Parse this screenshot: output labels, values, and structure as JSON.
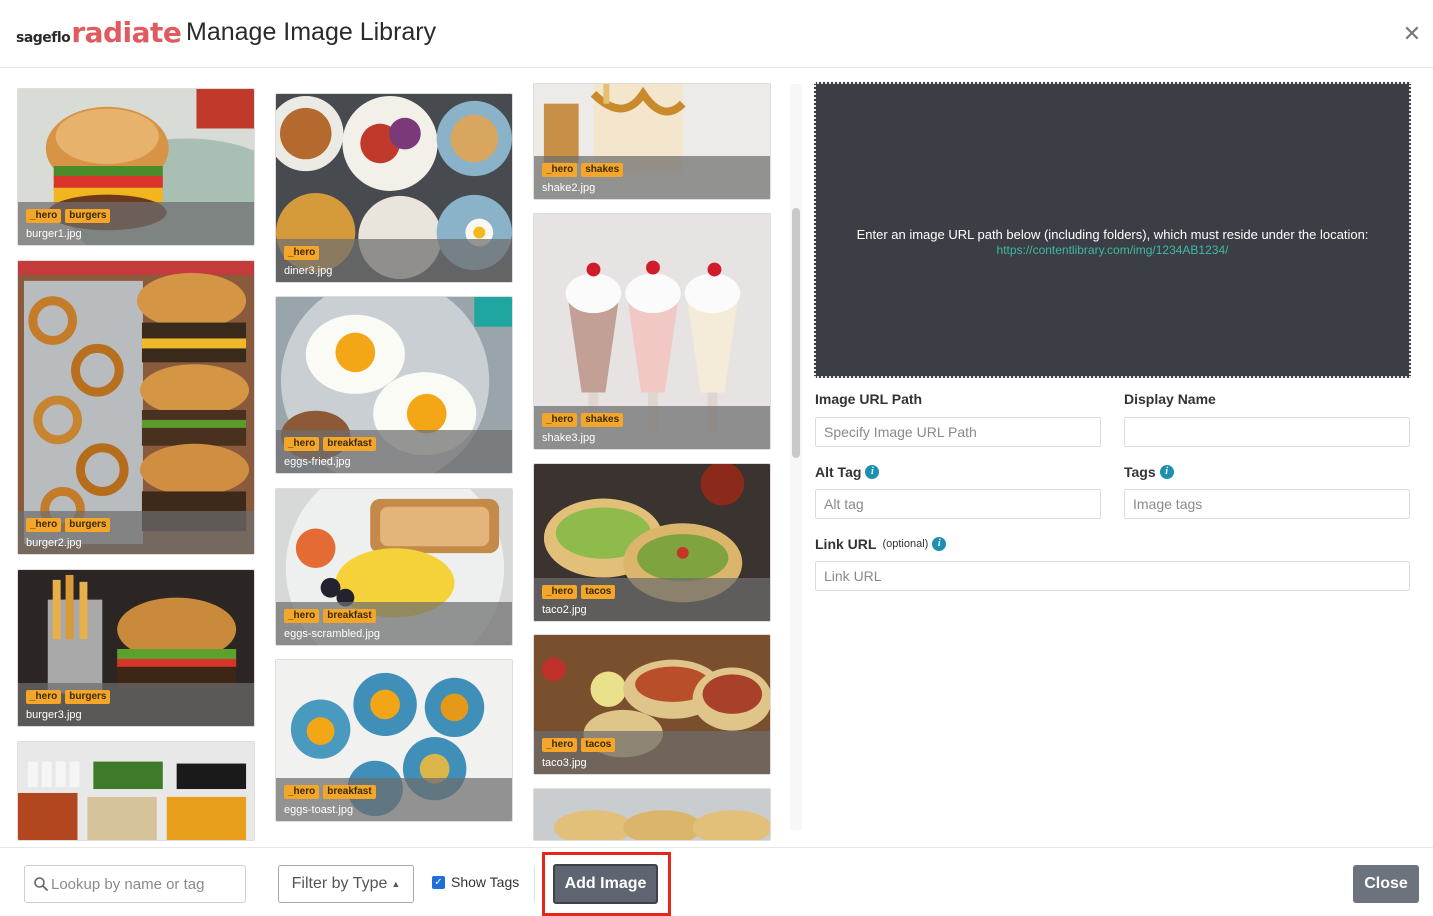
{
  "header": {
    "logo_small": "sageflo",
    "logo_big": "radiate",
    "title": "Manage Image Library"
  },
  "colors": {
    "brand": "#e05a5f",
    "tag": "#f3a62a",
    "link": "#3fb8a3",
    "info": "#1f8fb0",
    "highlight": "#e4261b"
  },
  "gallery": {
    "images": [
      {
        "file": "burger1.jpg",
        "tags": [
          "_hero",
          "burgers"
        ]
      },
      {
        "file": "burger2.jpg",
        "tags": [
          "_hero",
          "burgers"
        ]
      },
      {
        "file": "burger3.jpg",
        "tags": [
          "_hero",
          "burgers"
        ]
      },
      {
        "file": "",
        "tags": []
      },
      {
        "file": "diner3.jpg",
        "tags": [
          "_hero"
        ]
      },
      {
        "file": "eggs-fried.jpg",
        "tags": [
          "_hero",
          "breakfast"
        ]
      },
      {
        "file": "eggs-scrambled.jpg",
        "tags": [
          "_hero",
          "breakfast"
        ]
      },
      {
        "file": "eggs-toast.jpg",
        "tags": [
          "_hero",
          "breakfast"
        ]
      },
      {
        "file": "shake2.jpg",
        "tags": [
          "_hero",
          "shakes"
        ]
      },
      {
        "file": "shake3.jpg",
        "tags": [
          "_hero",
          "shakes"
        ]
      },
      {
        "file": "taco2.jpg",
        "tags": [
          "_hero",
          "tacos"
        ]
      },
      {
        "file": "taco3.jpg",
        "tags": [
          "_hero",
          "tacos"
        ]
      },
      {
        "file": "",
        "tags": []
      }
    ]
  },
  "panel": {
    "drop_text": "Enter an image URL path below (including folders), which must reside under the location:",
    "drop_url": "https://contentlibrary.com/img/1234AB1234/",
    "url_path_label": "Image URL Path",
    "url_path_placeholder": "Specify Image URL Path",
    "display_name_label": "Display Name",
    "display_name_value": "",
    "alt_tag_label": "Alt Tag",
    "alt_tag_placeholder": "Alt tag",
    "tags_label": "Tags",
    "tags_placeholder": "Image tags",
    "link_url_label": "Link URL",
    "link_url_optional": "(optional)",
    "link_url_placeholder": "Link URL"
  },
  "footer": {
    "search_placeholder": "Lookup by name or tag",
    "filter_label": "Filter by Type",
    "show_tags_label": "Show Tags",
    "show_tags_checked": true,
    "add_image_label": "Add Image",
    "close_label": "Close"
  }
}
